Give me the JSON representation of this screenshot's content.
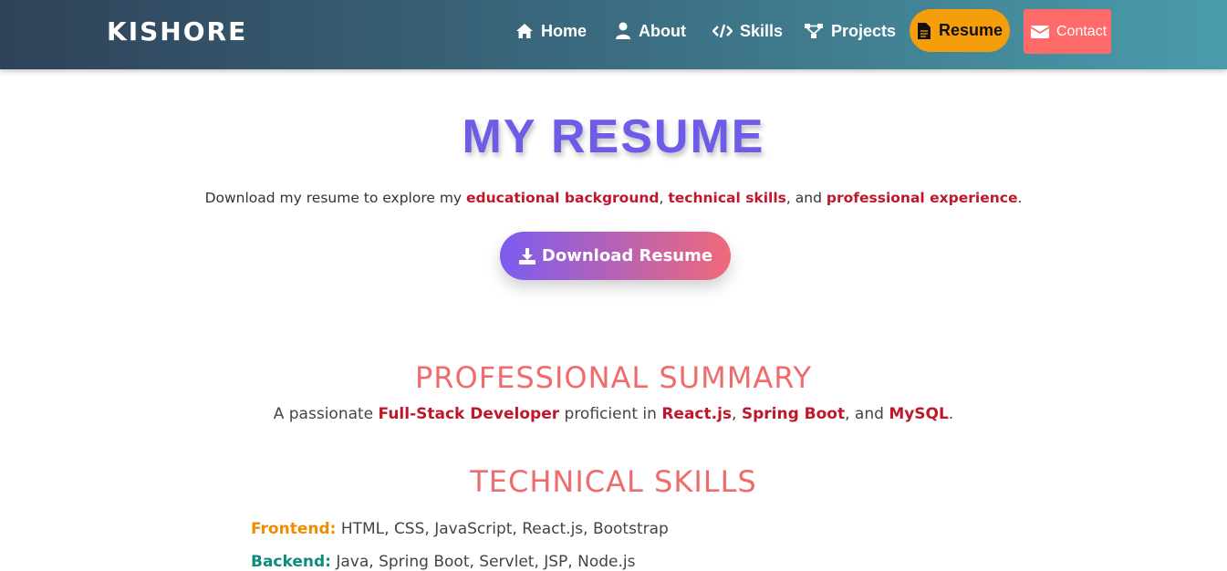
{
  "navbar": {
    "brand": "KISHORE",
    "items": [
      {
        "label": "Home",
        "icon": "home-icon"
      },
      {
        "label": "About",
        "icon": "user-icon"
      },
      {
        "label": "Skills",
        "icon": "code-icon"
      },
      {
        "label": "Projects",
        "icon": "sitemap-icon"
      },
      {
        "label": "Resume",
        "icon": "file-icon"
      },
      {
        "label": "Contact",
        "icon": "envelope-icon"
      }
    ],
    "colors": {
      "resume_bg": "#f59e0b",
      "contact_bg": "#ff6b6b"
    }
  },
  "main": {
    "title": "MY RESUME",
    "intro": {
      "prefix": "Download my resume to explore my ",
      "hl1": "educational background",
      "sep1": ", ",
      "hl2": "technical skills",
      "sep2": ", and ",
      "hl3": "professional experience",
      "suffix": "."
    },
    "download_label": "Download Resume"
  },
  "summary": {
    "title": "PROFESSIONAL SUMMARY",
    "prefix": "A passionate ",
    "role": "Full-Stack Developer",
    "mid": " proficient in ",
    "tech1": "React.js",
    "sep1": ", ",
    "tech2": "Spring Boot",
    "sep2": ", and ",
    "tech3": "MySQL",
    "suffix": "."
  },
  "skills": {
    "title": "TECHNICAL SKILLS",
    "rows": [
      {
        "label": "Frontend:",
        "value": " HTML, CSS, JavaScript, React.js, Bootstrap",
        "color": "#f08c00"
      },
      {
        "label": "Backend:",
        "value": " Java, Spring Boot, Servlet, JSP, Node.js",
        "color": "#0e8a7e"
      }
    ]
  }
}
